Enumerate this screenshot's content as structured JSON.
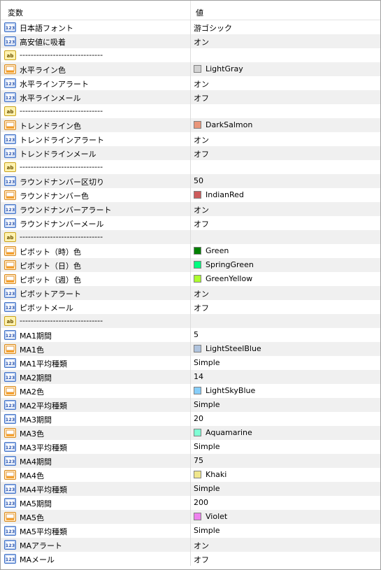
{
  "header": {
    "name_label": "変数",
    "value_label": "値"
  },
  "rows": [
    {
      "icon": "num",
      "name": "日本語フォント",
      "value": "游ゴシック"
    },
    {
      "icon": "num",
      "name": "高安値に吸着",
      "value": "オン"
    },
    {
      "icon": "str",
      "name": "------------------------------",
      "value": ""
    },
    {
      "icon": "color",
      "name": "水平ライン色",
      "value": "LightGray",
      "swatch": "#d3d3d3"
    },
    {
      "icon": "num",
      "name": "水平ラインアラート",
      "value": "オン"
    },
    {
      "icon": "num",
      "name": "水平ラインメール",
      "value": "オフ"
    },
    {
      "icon": "str",
      "name": "------------------------------",
      "value": ""
    },
    {
      "icon": "color",
      "name": "トレンドライン色",
      "value": "DarkSalmon",
      "swatch": "#e9967a"
    },
    {
      "icon": "num",
      "name": "トレンドラインアラート",
      "value": "オン"
    },
    {
      "icon": "num",
      "name": "トレンドラインメール",
      "value": "オフ"
    },
    {
      "icon": "str",
      "name": "------------------------------",
      "value": ""
    },
    {
      "icon": "num",
      "name": "ラウンドナンバー区切り",
      "value": "50"
    },
    {
      "icon": "color",
      "name": "ラウンドナンバー色",
      "value": "IndianRed",
      "swatch": "#cd5c5c"
    },
    {
      "icon": "num",
      "name": "ラウンドナンバーアラート",
      "value": "オン"
    },
    {
      "icon": "num",
      "name": "ラウンドナンバーメール",
      "value": "オフ"
    },
    {
      "icon": "str",
      "name": "------------------------------",
      "value": ""
    },
    {
      "icon": "color",
      "name": "ピボット（時）色",
      "value": "Green",
      "swatch": "#008000"
    },
    {
      "icon": "color",
      "name": "ピボット（日）色",
      "value": "SpringGreen",
      "swatch": "#00ff7f"
    },
    {
      "icon": "color",
      "name": "ピボット（週）色",
      "value": "GreenYellow",
      "swatch": "#adff2f"
    },
    {
      "icon": "num",
      "name": "ピボットアラート",
      "value": "オン"
    },
    {
      "icon": "num",
      "name": "ピボットメール",
      "value": "オフ"
    },
    {
      "icon": "str",
      "name": "------------------------------",
      "value": ""
    },
    {
      "icon": "num",
      "name": "MA1期間",
      "value": "5"
    },
    {
      "icon": "color",
      "name": "MA1色",
      "value": "LightSteelBlue",
      "swatch": "#b0c4de"
    },
    {
      "icon": "num",
      "name": "MA1平均種類",
      "value": "Simple"
    },
    {
      "icon": "num",
      "name": "MA2期間",
      "value": "14"
    },
    {
      "icon": "color",
      "name": "MA2色",
      "value": "LightSkyBlue",
      "swatch": "#87cefa"
    },
    {
      "icon": "num",
      "name": "MA2平均種類",
      "value": "Simple"
    },
    {
      "icon": "num",
      "name": "MA3期間",
      "value": "20"
    },
    {
      "icon": "color",
      "name": "MA3色",
      "value": "Aquamarine",
      "swatch": "#7fffd4"
    },
    {
      "icon": "num",
      "name": "MA3平均種類",
      "value": "Simple"
    },
    {
      "icon": "num",
      "name": "MA4期間",
      "value": "75"
    },
    {
      "icon": "color",
      "name": "MA4色",
      "value": "Khaki",
      "swatch": "#f0e68c"
    },
    {
      "icon": "num",
      "name": "MA4平均種類",
      "value": "Simple"
    },
    {
      "icon": "num",
      "name": "MA5期間",
      "value": "200"
    },
    {
      "icon": "color",
      "name": "MA5色",
      "value": "Violet",
      "swatch": "#ee82ee"
    },
    {
      "icon": "num",
      "name": "MA5平均種類",
      "value": "Simple"
    },
    {
      "icon": "num",
      "name": "MAアラート",
      "value": "オン"
    },
    {
      "icon": "num",
      "name": "MAメール",
      "value": "オフ"
    }
  ]
}
